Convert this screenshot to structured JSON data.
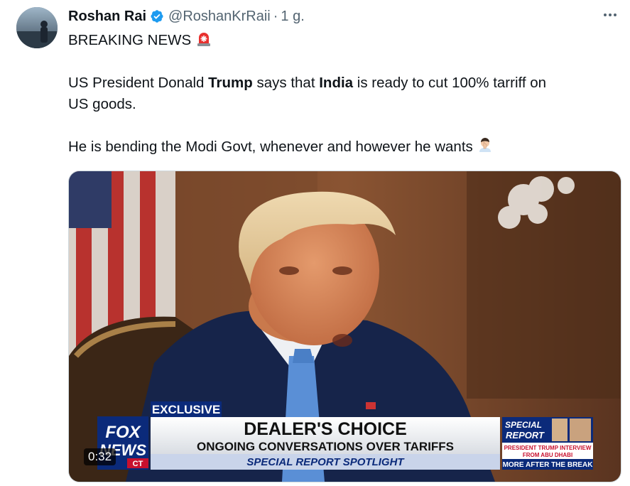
{
  "tweet": {
    "author_name": "Roshan Rai",
    "handle": "@RoshanKrRaii",
    "separator": "·",
    "time": "1 g.",
    "lines": {
      "l1_text": "BREAKING NEWS",
      "l1_emoji": "siren-emoji",
      "l2_a": "US President Donald ",
      "l2_bold1": "Trump",
      "l2_b": " says that ",
      "l2_bold2": "India",
      "l2_c": " is  ready to cut 100% tarriff on",
      "l3": "US goods.",
      "l4": "He is bending the Modi Govt,  whenever and however he wants",
      "l4_emoji": "facepalm-emoji"
    }
  },
  "video": {
    "timestamp": "0:32",
    "chyron": {
      "exclusive": "EXCLUSIVE",
      "headline": "DEALER'S CHOICE",
      "subline": "ONGOING CONVERSATIONS OVER TARIFFS",
      "spotlight": "SPECIAL REPORT SPOTLIGHT",
      "logo_top": "FOX",
      "logo_bottom": "NEWS",
      "logo_channel": "CT",
      "special_report_1": "SPECIAL",
      "special_report_2": "REPORT",
      "side_line1": "PRESIDENT TRUMP INTERVIEW",
      "side_line2": "FROM ABU DHABI",
      "side_line3": "MORE AFTER THE BREAK"
    }
  },
  "colors": {
    "verified_blue": "#1d9bf0",
    "text_primary": "#0f1419",
    "text_secondary": "#536471",
    "fox_blue": "#0b2a7a",
    "fox_red": "#c8102e"
  }
}
